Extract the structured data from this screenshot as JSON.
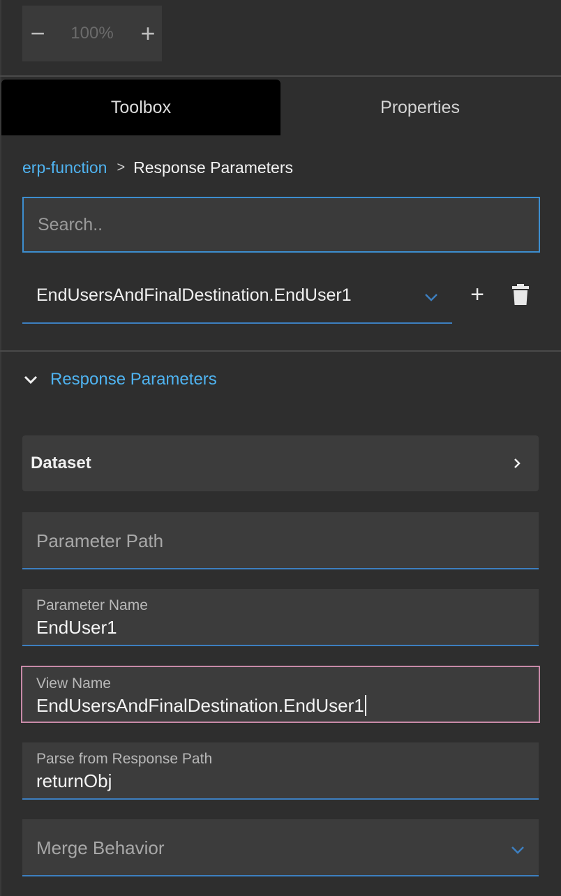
{
  "zoom": {
    "minus_label": "−",
    "value": "100%",
    "plus_label": "+"
  },
  "tabs": {
    "toolbox": "Toolbox",
    "properties": "Properties"
  },
  "breadcrumb": {
    "root": "erp-function",
    "separator": ">",
    "current": "Response Parameters"
  },
  "search": {
    "placeholder": "Search.."
  },
  "selector": {
    "value": "EndUsersAndFinalDestination.EndUser1",
    "add_label": "+"
  },
  "section": {
    "title": "Response Parameters"
  },
  "dataset": {
    "label": "Dataset"
  },
  "fields": {
    "parameter_path": {
      "placeholder": "Parameter Path"
    },
    "parameter_name": {
      "label": "Parameter Name",
      "value": "EndUser1"
    },
    "view_name": {
      "label": "View Name",
      "value": "EndUsersAndFinalDestination.EndUser1"
    },
    "parse_path": {
      "label": "Parse from Response Path",
      "value": "returnObj"
    },
    "merge_behavior": {
      "placeholder": "Merge Behavior"
    }
  },
  "colors": {
    "accent": "#4fb3f0",
    "underline": "#3d7fc0",
    "focus_border": "#c88aa8",
    "background": "#2e2e2e"
  }
}
